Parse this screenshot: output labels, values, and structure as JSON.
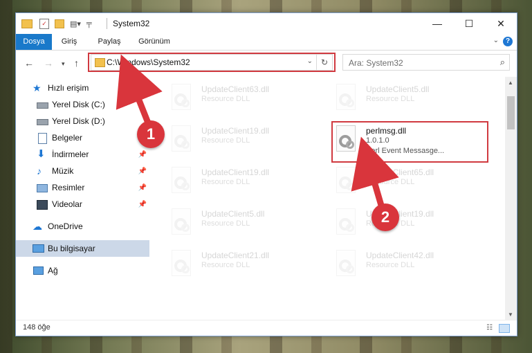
{
  "window": {
    "title": "System32",
    "controls": {
      "minimize": "—",
      "maximize": "☐",
      "close": "✕"
    }
  },
  "ribbon": {
    "tabs": [
      {
        "label": "Dosya",
        "active": true
      },
      {
        "label": "Giriş"
      },
      {
        "label": "Paylaş"
      },
      {
        "label": "Görünüm"
      }
    ],
    "help": "?"
  },
  "address": {
    "path": "C:\\Windows\\System32",
    "search_placeholder": "Ara: System32"
  },
  "sidebar": {
    "items": [
      {
        "label": "Hızlı erişim",
        "icon": "star-icon"
      },
      {
        "label": "Yerel Disk (C:)",
        "icon": "drive-icon"
      },
      {
        "label": "Yerel Disk (D:)",
        "icon": "drive-icon"
      },
      {
        "label": "Belgeler",
        "icon": "documents-icon"
      },
      {
        "label": "İndirmeler",
        "icon": "download-icon"
      },
      {
        "label": "Müzik",
        "icon": "music-icon"
      },
      {
        "label": "Resimler",
        "icon": "pictures-icon"
      },
      {
        "label": "Videolar",
        "icon": "video-icon"
      },
      {
        "label": "OneDrive",
        "icon": "cloud-icon"
      },
      {
        "label": "Bu bilgisayar",
        "icon": "computer-icon"
      },
      {
        "label": "Ağ",
        "icon": "network-icon"
      }
    ]
  },
  "files": [
    {
      "name": "UpdateClient63.dll",
      "type": "Resource DLL"
    },
    {
      "name": "UpdateClient5.dll",
      "type": "Resource DLL"
    },
    {
      "name": "UpdateClient19.dll",
      "type": "Resource DLL"
    },
    {
      "name": "perlmsg.dll",
      "type": "1.0.1.0",
      "desc": "Perl Event Messasge..."
    },
    {
      "name": "UpdateClient19.dll",
      "type": "Resource DLL"
    },
    {
      "name": "UpdateClient65.dll",
      "type": "Resource DLL"
    },
    {
      "name": "UpdateClient5.dll",
      "type": "Resource DLL"
    },
    {
      "name": "UpdateClient19.dll",
      "type": "Resource DLL"
    },
    {
      "name": "UpdateClient21.dll",
      "type": "Resource DLL"
    },
    {
      "name": "UpdateClient42.dll",
      "type": "Resource DLL"
    }
  ],
  "status": {
    "count": "148 öğe"
  },
  "annotations": {
    "badge1": "1",
    "badge2": "2",
    "color": "#d9353c"
  }
}
